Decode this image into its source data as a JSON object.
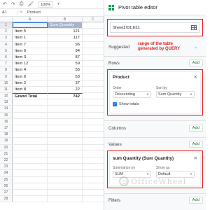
{
  "toolbar": {
    "zoom": "100%",
    "undo_icon": "undo-icon",
    "redo_icon": "redo-icon",
    "print_icon": "print-icon",
    "paint_format_icon": "paint-format-icon"
  },
  "formula_bar": {
    "cell_ref": "A1",
    "fx": "fx",
    "value": "Product"
  },
  "columns": [
    "A",
    "B",
    "C"
  ],
  "rows": [
    {
      "n": "1",
      "a": "Product",
      "b": "Sum Quantity",
      "kind": "header"
    },
    {
      "n": "2",
      "a": "Item 5",
      "b": "121"
    },
    {
      "n": "3",
      "a": "Item 1",
      "b": "117"
    },
    {
      "n": "4",
      "a": "Item 7",
      "b": "96"
    },
    {
      "n": "5",
      "a": "Item 9",
      "b": "94"
    },
    {
      "n": "6",
      "a": "Item 3",
      "b": "87"
    },
    {
      "n": "7",
      "a": "Item 12",
      "b": "59"
    },
    {
      "n": "8",
      "a": "Item 4",
      "b": "55"
    },
    {
      "n": "9",
      "a": "Item 6",
      "b": "53"
    },
    {
      "n": "10",
      "a": "Item 2",
      "b": "37"
    },
    {
      "n": "11",
      "a": "Item 8",
      "b": "22"
    },
    {
      "n": "12",
      "a": "Grand Total",
      "b": "742",
      "kind": "total"
    },
    {
      "n": "13",
      "a": "",
      "b": ""
    },
    {
      "n": "14",
      "a": "",
      "b": ""
    },
    {
      "n": "15",
      "a": "",
      "b": ""
    },
    {
      "n": "16",
      "a": "",
      "b": ""
    },
    {
      "n": "17",
      "a": "",
      "b": ""
    },
    {
      "n": "18",
      "a": "",
      "b": ""
    },
    {
      "n": "19",
      "a": "",
      "b": ""
    },
    {
      "n": "20",
      "a": "",
      "b": ""
    },
    {
      "n": "21",
      "a": "",
      "b": ""
    },
    {
      "n": "22",
      "a": "",
      "b": ""
    },
    {
      "n": "23",
      "a": "",
      "b": ""
    },
    {
      "n": "24",
      "a": "",
      "b": ""
    },
    {
      "n": "25",
      "a": "",
      "b": ""
    },
    {
      "n": "26",
      "a": "",
      "b": ""
    },
    {
      "n": "27",
      "a": "",
      "b": ""
    },
    {
      "n": "28",
      "a": "",
      "b": ""
    }
  ],
  "pivot": {
    "title": "Pivot table editor",
    "range": "Sheet1!D1:E11",
    "suggested_label": "Suggested",
    "annotation": "range of the table generated by QUERY",
    "rows_label": "Rows",
    "add_label": "Add",
    "rows_card": {
      "title": "Product",
      "order_label": "Order",
      "order_value": "Descending",
      "sortby_label": "Sort by",
      "sortby_value": "Sum Quantity",
      "show_totals": "Show totals"
    },
    "columns_label": "Columns",
    "values_label": "Values",
    "values_card": {
      "title": "sum Quantity (Sum Quantity)",
      "summarize_label": "Summarize by",
      "summarize_value": "SUM",
      "showas_label": "Show as",
      "showas_value": "Default"
    },
    "filters_label": "Filters"
  },
  "watermark": "OfficeWheel",
  "colors": {
    "header_fill": "#a4b5d1",
    "annotation": "#e31d1d",
    "add_green": "#188038",
    "check_blue": "#1a73e8"
  }
}
